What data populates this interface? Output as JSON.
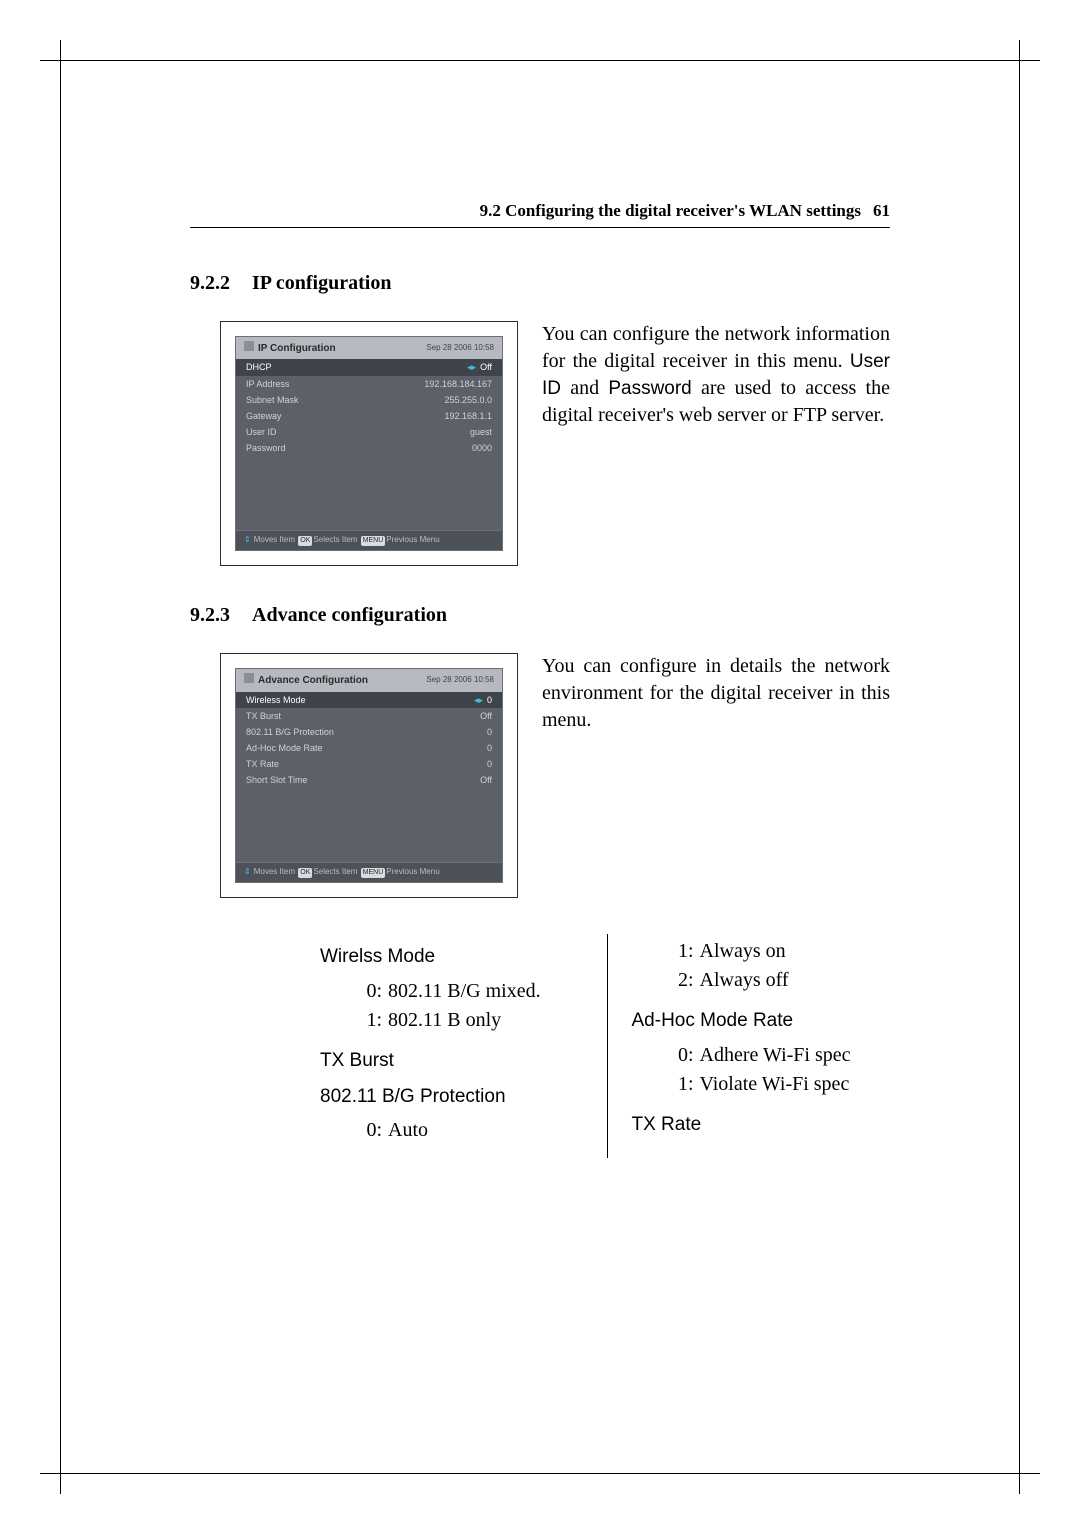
{
  "header": {
    "section": "9.2 Configuring the digital receiver's WLAN settings",
    "page_number": "61"
  },
  "sections": {
    "ip": {
      "number": "9.2.2",
      "title": "IP configuration",
      "body_pre": "You can configure the network information for the digital receiver in this menu. ",
      "ui_userid": "User ID",
      "body_mid": " and ",
      "ui_password": "Password",
      "body_post": " are used to access the digital receiver's web server or FTP server."
    },
    "adv": {
      "number": "9.2.3",
      "title": "Advance configuration",
      "body": "You can configure in details the network environment for the digital receiver in this menu."
    }
  },
  "osd_common": {
    "timestamp": "Sep 28 2006 10:58",
    "footer_moves": "Moves Item",
    "footer_ok": "OK",
    "footer_selects": "Selects Item",
    "footer_menu": "MENU",
    "footer_prev": "Previous Menu",
    "updown": "⇕"
  },
  "osd_ip": {
    "title": "IP Configuration",
    "rows": [
      {
        "label": "DHCP",
        "value": "Off",
        "selected": true
      },
      {
        "label": "IP Address",
        "value": "192.168.184.167"
      },
      {
        "label": "Subnet Mask",
        "value": "255.255.0.0"
      },
      {
        "label": "Gateway",
        "value": "192.168.1.1"
      },
      {
        "label": "User ID",
        "value": "guest"
      },
      {
        "label": "Password",
        "value": "0000"
      }
    ]
  },
  "osd_adv": {
    "title": "Advance Configuration",
    "rows": [
      {
        "label": "Wireless Mode",
        "value": "0",
        "selected": true
      },
      {
        "label": "TX Burst",
        "value": "Off"
      },
      {
        "label": "802.11 B/G Protection",
        "value": "0"
      },
      {
        "label": "Ad-Hoc Mode Rate",
        "value": "0"
      },
      {
        "label": "TX Rate",
        "value": "0"
      },
      {
        "label": "Short Slot Time",
        "value": "Off"
      }
    ]
  },
  "defs": {
    "left": {
      "wireless_mode": {
        "term": "Wirelss Mode",
        "opts": [
          {
            "k": "0:",
            "v": "802.11 B/G mixed."
          },
          {
            "k": "1:",
            "v": "802.11 B only"
          }
        ]
      },
      "tx_burst": {
        "term": "TX Burst"
      },
      "bg_prot": {
        "term": "802.11 B/G Protection",
        "opts": [
          {
            "k": "0:",
            "v": "Auto"
          }
        ]
      }
    },
    "right": {
      "cont_opts": [
        {
          "k": "1:",
          "v": "Always on"
        },
        {
          "k": "2:",
          "v": "Always off"
        }
      ],
      "adhoc": {
        "term": "Ad-Hoc Mode Rate",
        "opts": [
          {
            "k": "0:",
            "v": "Adhere Wi-Fi spec"
          },
          {
            "k": "1:",
            "v": "Violate Wi-Fi spec"
          }
        ]
      },
      "tx_rate": {
        "term": "TX Rate"
      }
    }
  }
}
